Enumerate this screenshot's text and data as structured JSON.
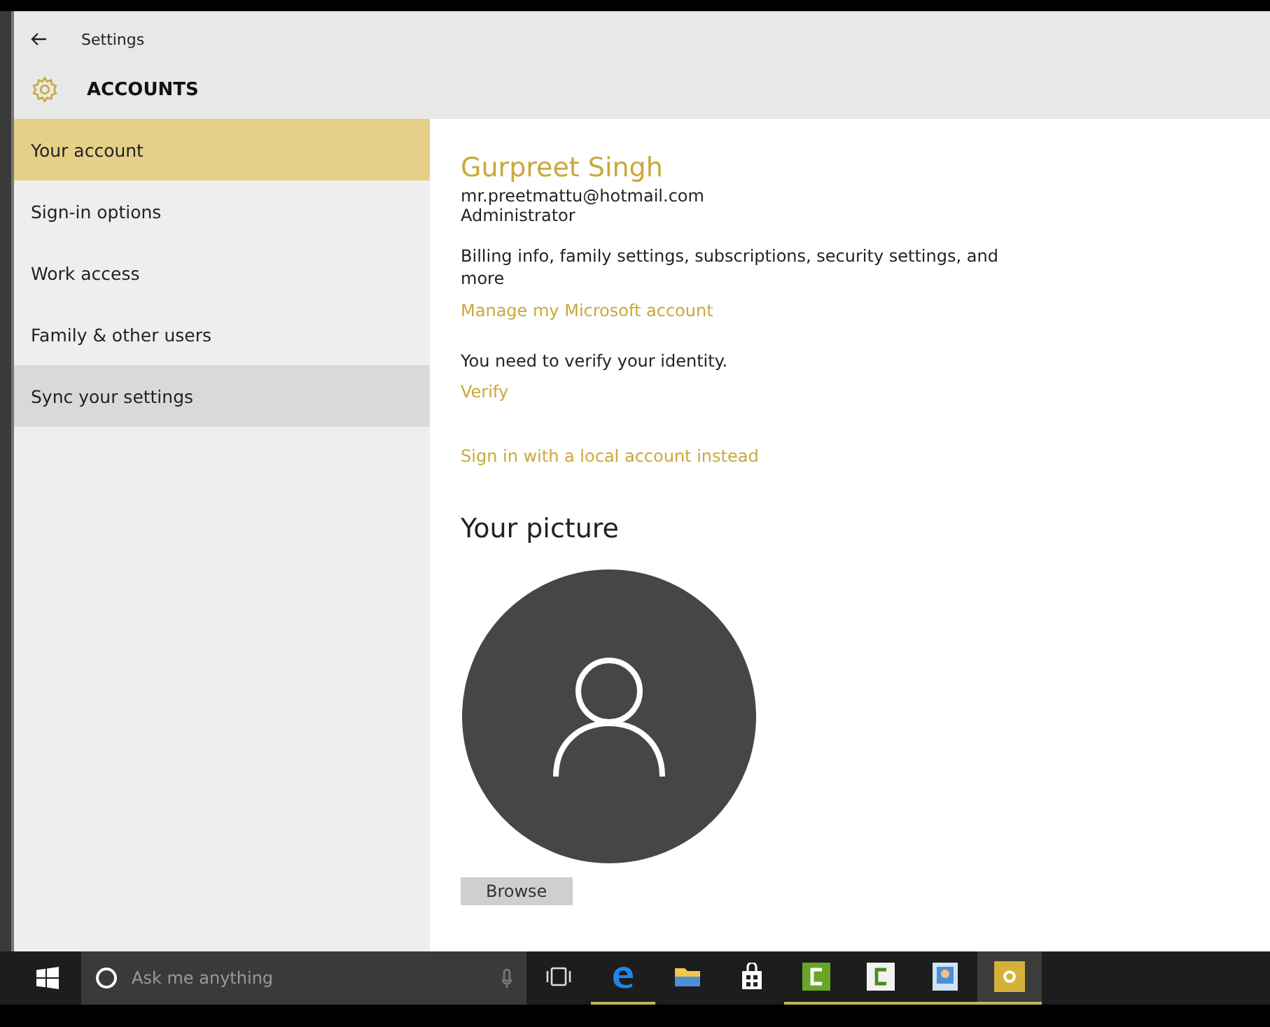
{
  "window": {
    "title": "Settings"
  },
  "header": {
    "title": "ACCOUNTS"
  },
  "sidebar": {
    "items": [
      {
        "label": "Your account",
        "selected": true,
        "hovered": false
      },
      {
        "label": "Sign-in options",
        "selected": false,
        "hovered": false
      },
      {
        "label": "Work access",
        "selected": false,
        "hovered": false
      },
      {
        "label": "Family & other users",
        "selected": false,
        "hovered": false
      },
      {
        "label": "Sync your settings",
        "selected": false,
        "hovered": true
      }
    ]
  },
  "account": {
    "name": "Gurpreet Singh",
    "email": "mr.preetmattu@hotmail.com",
    "role": "Administrator",
    "description": "Billing info, family settings, subscriptions, security settings, and more",
    "manage_link": "Manage my Microsoft account",
    "verify_message": "You need to verify your identity.",
    "verify_link": "Verify",
    "local_account_link": "Sign in with a local account instead"
  },
  "picture": {
    "heading": "Your picture",
    "button": "Browse"
  },
  "taskbar": {
    "search_placeholder": "Ask me anything",
    "apps": [
      {
        "kind": "task-view",
        "running": false,
        "active": false
      },
      {
        "kind": "browser",
        "running": true,
        "active": false
      },
      {
        "kind": "folder",
        "running": false,
        "active": false
      },
      {
        "kind": "store",
        "running": false,
        "active": false
      },
      {
        "kind": "green-app",
        "running": true,
        "active": false
      },
      {
        "kind": "white-app",
        "running": true,
        "active": false
      },
      {
        "kind": "photo-app",
        "running": true,
        "active": false
      },
      {
        "kind": "settings",
        "running": true,
        "active": true
      }
    ]
  }
}
